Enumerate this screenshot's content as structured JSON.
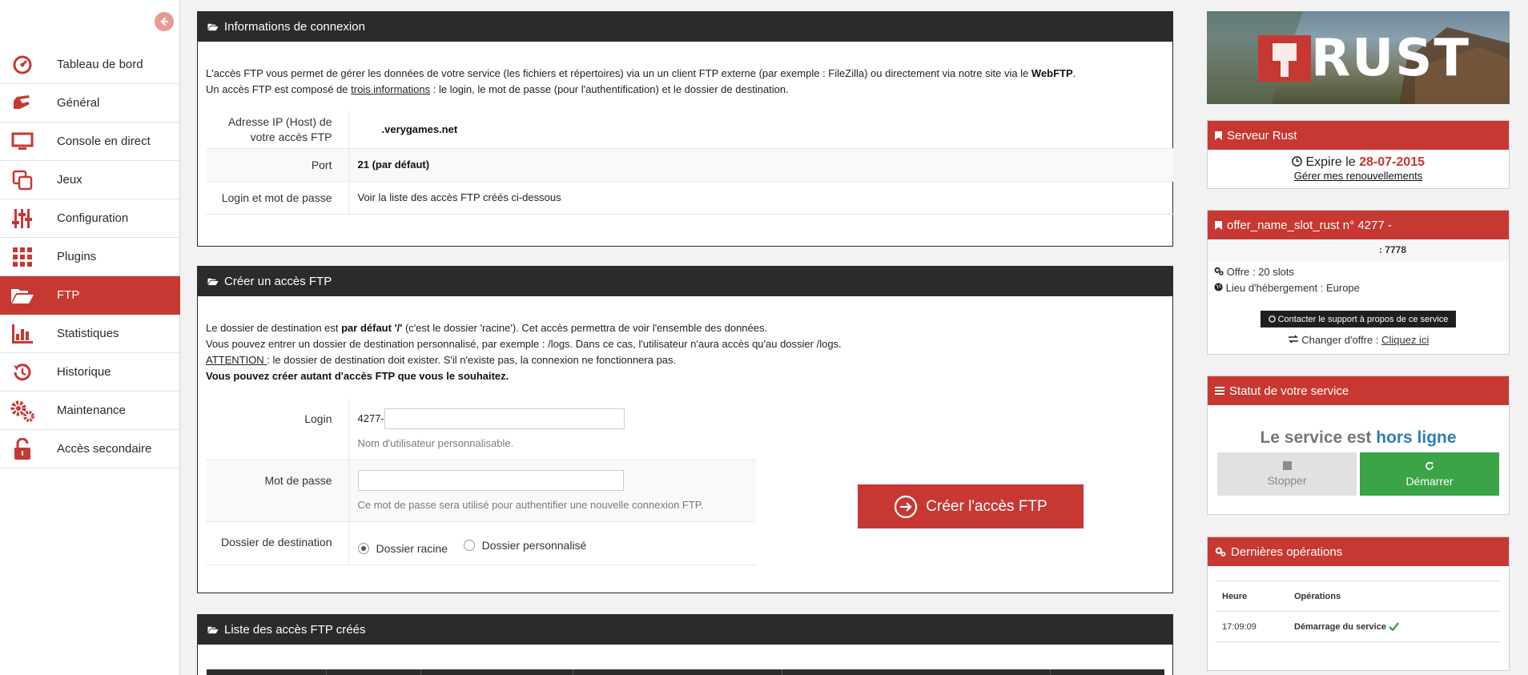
{
  "sidebar": {
    "items": [
      {
        "label": "Tableau de bord",
        "icon": "dashboard-icon"
      },
      {
        "label": "Général",
        "icon": "hand-icon"
      },
      {
        "label": "Console en direct",
        "icon": "monitor-icon"
      },
      {
        "label": "Jeux",
        "icon": "copy-icon"
      },
      {
        "label": "Configuration",
        "icon": "sliders-icon"
      },
      {
        "label": "Plugins",
        "icon": "grid-icon"
      },
      {
        "label": "FTP",
        "icon": "folder-open-icon"
      },
      {
        "label": "Statistiques",
        "icon": "bar-chart-icon"
      },
      {
        "label": "Historique",
        "icon": "history-icon"
      },
      {
        "label": "Maintenance",
        "icon": "gears-icon"
      },
      {
        "label": "Accès secondaire",
        "icon": "unlock-icon"
      }
    ],
    "active": "FTP"
  },
  "info": {
    "title": "Informations de connexion",
    "p1_a": "L'accès FTP vous permet de gérer les données de votre service (les fichiers et répertoires) via un un client FTP externe (par exemple : FileZilla) ou directement via notre site via le ",
    "p1_b": "WebFTP",
    "p1_c": ".",
    "p2_a": "Un accès FTP est composé de ",
    "p2_b": "trois informations",
    "p2_c": " : le login, le mot de passe (pour l'authentification) et le dossier de destination.",
    "rows": [
      {
        "label": "Adresse IP (Host) de votre accès FTP",
        "value": ".verygames.net"
      },
      {
        "label": "Port",
        "value": "21 (par défaut)"
      },
      {
        "label": "Login et mot de passe",
        "value": "Voir la liste des accès FTP créés ci-dessous"
      }
    ]
  },
  "create": {
    "title": "Créer un accès FTP",
    "l1_a": "Le dossier de destination est ",
    "l1_b": "par défaut '/'",
    "l1_c": " (c'est le dossier 'racine'). Cet accès permettra de voir l'ensemble des données.",
    "l2": "Vous pouvez entrer un dossier de destination personnalisé, par exemple : /logs. Dans ce cas, l'utilisateur n'aura accès qu'au dossier /logs.",
    "l3_a": "ATTENTION ",
    "l3_b": ": le dossier de destination doit exister. S'il n'existe pas, la connexion ne fonctionnera pas.",
    "l4": "Vous pouvez créer autant d'accès FTP que vous le souhaitez.",
    "login_label": "Login",
    "login_prefix": "4277-",
    "login_value": "",
    "login_help": "Nom d'utilisateur personnalisable.",
    "password_label": "Mot de passe",
    "password_value": "",
    "password_help": "Ce mot de passe sera utilisé pour authentifier une nouvelle connexion FTP.",
    "dest_label": "Dossier de destination",
    "radio_root": "Dossier racine",
    "radio_custom": "Dossier personnalisé",
    "radio_selected": "root",
    "button": "Créer l'accès FTP"
  },
  "list": {
    "title": "Liste des accès FTP créés"
  },
  "right": {
    "banner_text": "RUST",
    "server": {
      "title": "Serveur Rust",
      "expire_label": "Expire le",
      "expire_date": "28-07-2015",
      "renew_link": "Gérer mes renouvellements"
    },
    "offer": {
      "title": "offer_name_slot_rust n° 4277 -",
      "port": ": 7778",
      "slots": "Offre : 20 slots",
      "location": "Lieu d'hébergement : Europe",
      "support_btn": "Contacter le support à propos de ce service",
      "change_label": "Changer d'offre :",
      "change_link": "Cliquez ici"
    },
    "status": {
      "title": "Statut de votre service",
      "text_a": "Le service est ",
      "text_b": "hors ligne",
      "stop": "Stopper",
      "start": "Démarrer"
    },
    "ops": {
      "title": "Dernières opérations",
      "col_time": "Heure",
      "col_ops": "Opérations",
      "rows": [
        {
          "time": "17:09:09",
          "op": "Démarrage du service"
        }
      ]
    }
  },
  "colors": {
    "accent": "#c73833",
    "dark": "#2b2b2b",
    "link": "#2f7fb5",
    "success": "#3aa447"
  }
}
